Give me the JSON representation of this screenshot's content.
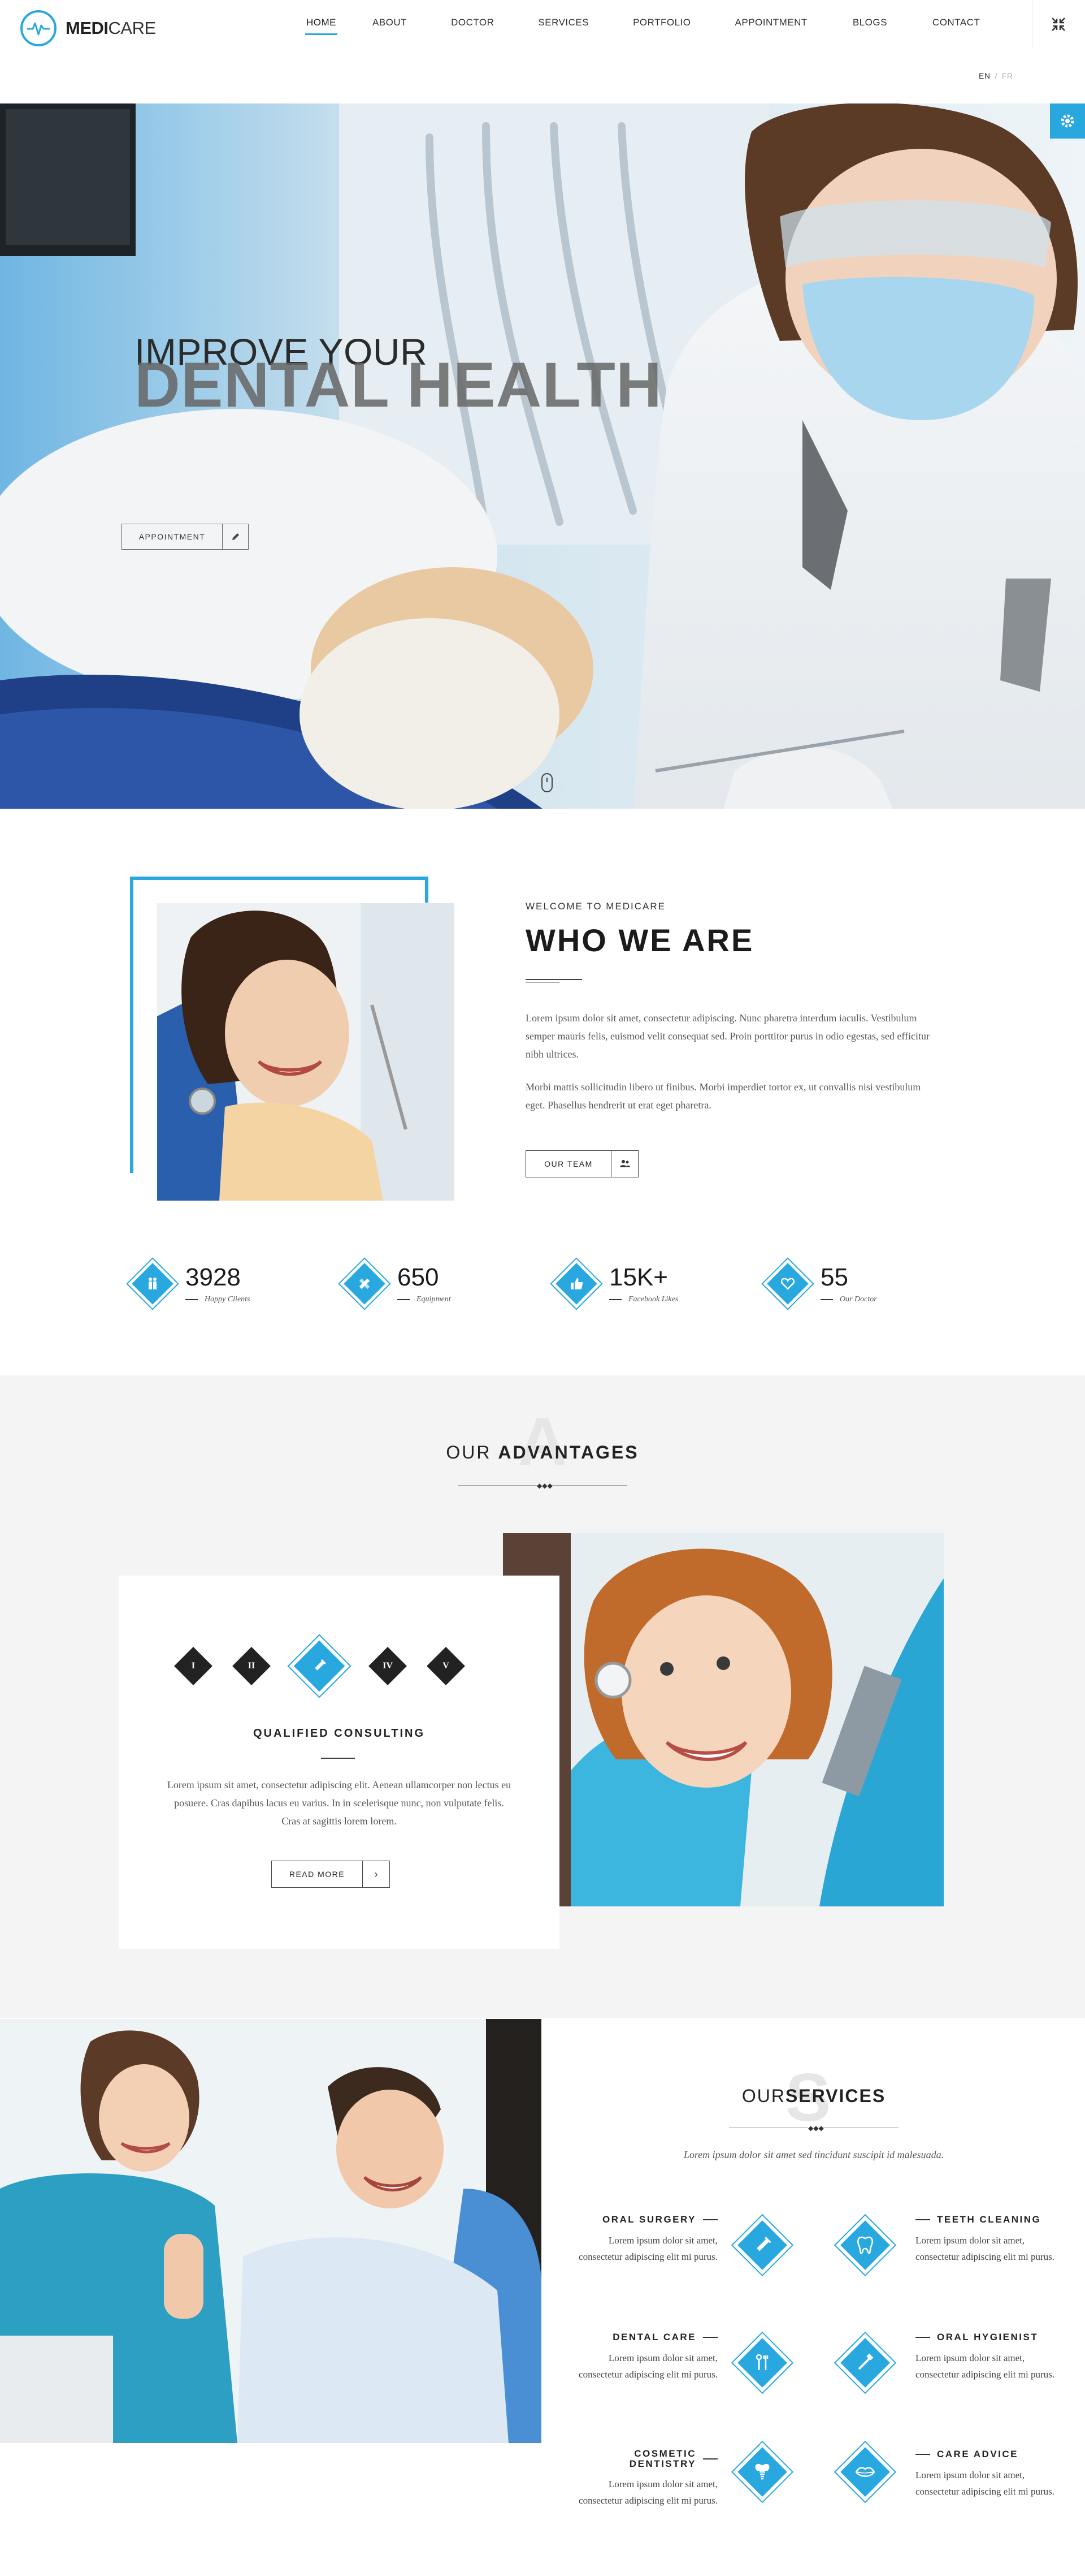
{
  "brand": {
    "name_bold": "MEDI",
    "name_light": "CARE",
    "accent": "#29a8e0"
  },
  "nav": {
    "items": [
      "HOME",
      "ABOUT",
      "DOCTOR",
      "SERVICES",
      "PORTFOLIO",
      "APPOINTMENT",
      "BLOGS",
      "CONTACT"
    ],
    "active": "HOME"
  },
  "lang": {
    "en": "EN",
    "sep": "/",
    "fr": "FR"
  },
  "hero": {
    "line1": "IMPROVE YOUR",
    "line2": "DENTAL HEALTH",
    "button": "APPOINTMENT"
  },
  "about": {
    "eyebrow": "WELCOME TO MEDICARE",
    "title": "WHO WE ARE",
    "p1": "Lorem ipsum dolor sit amet, consectetur adipiscing. Nunc pharetra interdum iaculis. Vestibulum semper mauris felis, euismod velit consequat sed. Proin porttitor purus in odio egestas, sed efficitur nibh ultrices.",
    "p2": "Morbi mattis sollicitudin libero ut finibus. Morbi imperdiet tortor ex, ut convallis nisi vestibulum eget. Phasellus hendrerit ut erat eget pharetra.",
    "button": "OUR TEAM"
  },
  "stats": [
    {
      "value": "3928",
      "label": "Happy Clients",
      "icon": "people-icon"
    },
    {
      "value": "650",
      "label": "Equipment",
      "icon": "equipment-icon"
    },
    {
      "value": "15K+",
      "label": "Facebook Likes",
      "icon": "thumbs-up-icon"
    },
    {
      "value": "55",
      "label": "Our Doctor",
      "icon": "heart-icon"
    }
  ],
  "advantages": {
    "ghost": "A",
    "title_light": "OUR ",
    "title_bold": "ADVANTAGES",
    "tabs": [
      "I",
      "II",
      "",
      "IV",
      "V"
    ],
    "card_title": "QUALIFIED CONSULTING",
    "card_text": "Lorem ipsum sit amet, consectetur adipiscing elit. Aenean ullamcorper non lectus eu posuere. Cras dapibus lacus eu varius. In in scelerisque nunc, non vulputate felis. Cras at sagittis lorem lorem.",
    "button": "READ MORE"
  },
  "services": {
    "ghost": "S",
    "title_light": "OUR",
    "title_bold": "SERVICES",
    "subtitle": "Lorem ipsum dolor sit amet sed tincidunt suscipit id malesuada.",
    "items": [
      {
        "title": "ORAL SURGERY",
        "text": "Lorem ipsum dolor sit amet, consectetur adipiscing elit mi purus.",
        "icon": "syringe-icon"
      },
      {
        "title": "TEETH CLEANING",
        "text": "Lorem ipsum dolor sit amet, consectetur adipiscing elit mi purus.",
        "icon": "tooth-icon"
      },
      {
        "title": "DENTAL CARE",
        "text": "Lorem ipsum dolor sit amet, consectetur adipiscing elit mi purus.",
        "icon": "dental-tools-icon"
      },
      {
        "title": "ORAL HYGIENIST",
        "text": "Lorem ipsum dolor sit amet, consectetur adipiscing elit mi purus.",
        "icon": "toothbrush-icon"
      },
      {
        "title": "COSMETIC DENTISTRY",
        "text": "Lorem ipsum dolor sit amet, consectetur adipiscing elit mi purus.",
        "icon": "implant-icon"
      },
      {
        "title": "CARE ADVICE",
        "text": "Lorem ipsum dolor sit amet, consectetur adipiscing elit mi purus.",
        "icon": "lips-icon"
      }
    ]
  }
}
